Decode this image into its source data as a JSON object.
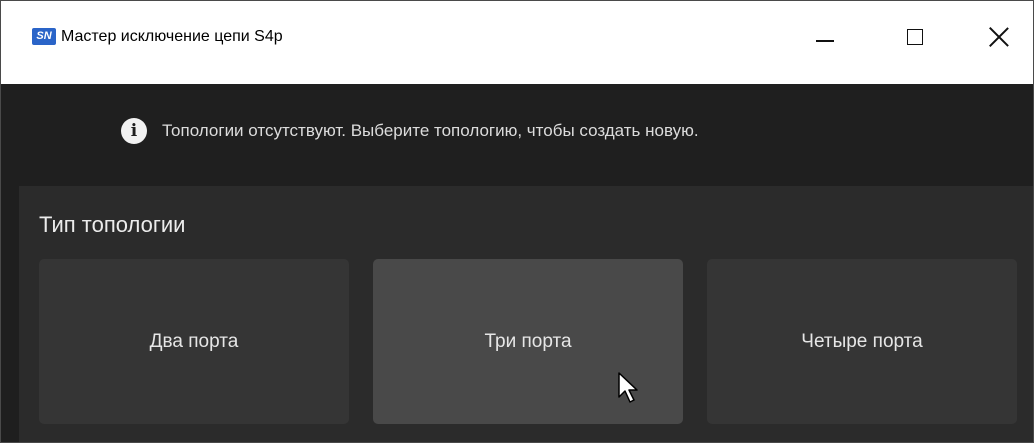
{
  "window": {
    "app_icon_text": "SN",
    "title": "Мастер исключение цепи S4p",
    "controls": [
      "minimize-icon",
      "maximize-icon",
      "close-icon"
    ]
  },
  "info": {
    "icon": "info-icon",
    "message": "Топологии отсутствуют. Выберите топологию, чтобы создать новую."
  },
  "topology": {
    "heading": "Тип топологии",
    "options": [
      {
        "label": "Два порта",
        "state": "normal"
      },
      {
        "label": "Три порта",
        "state": "hover"
      },
      {
        "label": "Четыре порта",
        "state": "normal"
      }
    ]
  },
  "colors": {
    "background": "#1f1f1f",
    "panel": "#2b2b2b",
    "button": "#353535",
    "button_hover": "#494949",
    "app_icon": "#2a64c8"
  }
}
